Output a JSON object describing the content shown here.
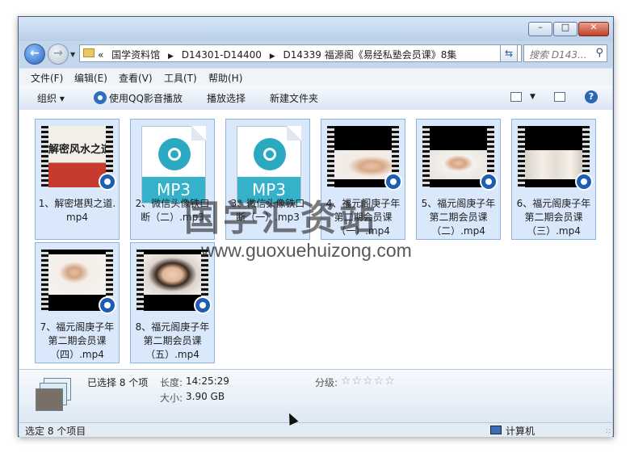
{
  "window": {
    "caption_buttons": {
      "minimize": "–",
      "maximize": "□",
      "close": "✕"
    }
  },
  "nav": {
    "back_icon": "arrow-left-icon",
    "forward_icon": "arrow-right-icon",
    "breadcrumbs": [
      "«",
      "国学资料馆",
      "D14301-D14400",
      "D14339 福源阁《易经私塾会员课》8集"
    ],
    "search_placeholder": "搜索 D143..."
  },
  "menu": [
    "文件(F)",
    "编辑(E)",
    "查看(V)",
    "工具(T)",
    "帮助(H)"
  ],
  "toolbar": {
    "organize": "组织 ▾",
    "play_qq": "使用QQ影音播放",
    "play_selection": "播放选择",
    "new_folder": "新建文件夹",
    "help": "?"
  },
  "files": [
    {
      "name": "1、解密堪舆之道.mp4",
      "type": "video",
      "thumb_text": "解密风水之道"
    },
    {
      "name": "2、微信头像铁口断（二）.mp3",
      "type": "audio",
      "thumb_text": "MP3"
    },
    {
      "name": "3、微信头像铁口断（一）.mp3",
      "type": "audio",
      "thumb_text": "MP3"
    },
    {
      "name": "4、福元阁庚子年第二期会员课（一）.mp4",
      "type": "video"
    },
    {
      "name": "5、福元阁庚子年第二期会员课（二）.mp4",
      "type": "video"
    },
    {
      "name": "6、福元阁庚子年第二期会员课（三）.mp4",
      "type": "video"
    },
    {
      "name": "7、福元阁庚子年第二期会员课（四）.mp4",
      "type": "video"
    },
    {
      "name": "8、福元阁庚子年第二期会员课（五）.mp4",
      "type": "video"
    }
  ],
  "watermark": {
    "title": "国学汇资站",
    "url": "www.guoxuehuizong.com"
  },
  "details": {
    "selected": "已选择 8 个项",
    "length_label": "长度:",
    "length_value": "14:25:29",
    "size_label": "大小:",
    "size_value": "3.90 GB",
    "rating_label": "分级:",
    "rating_stars": "☆☆☆☆☆",
    "rating_value": 0
  },
  "status": {
    "left": "选定 8 个项目",
    "right": "计算机"
  }
}
